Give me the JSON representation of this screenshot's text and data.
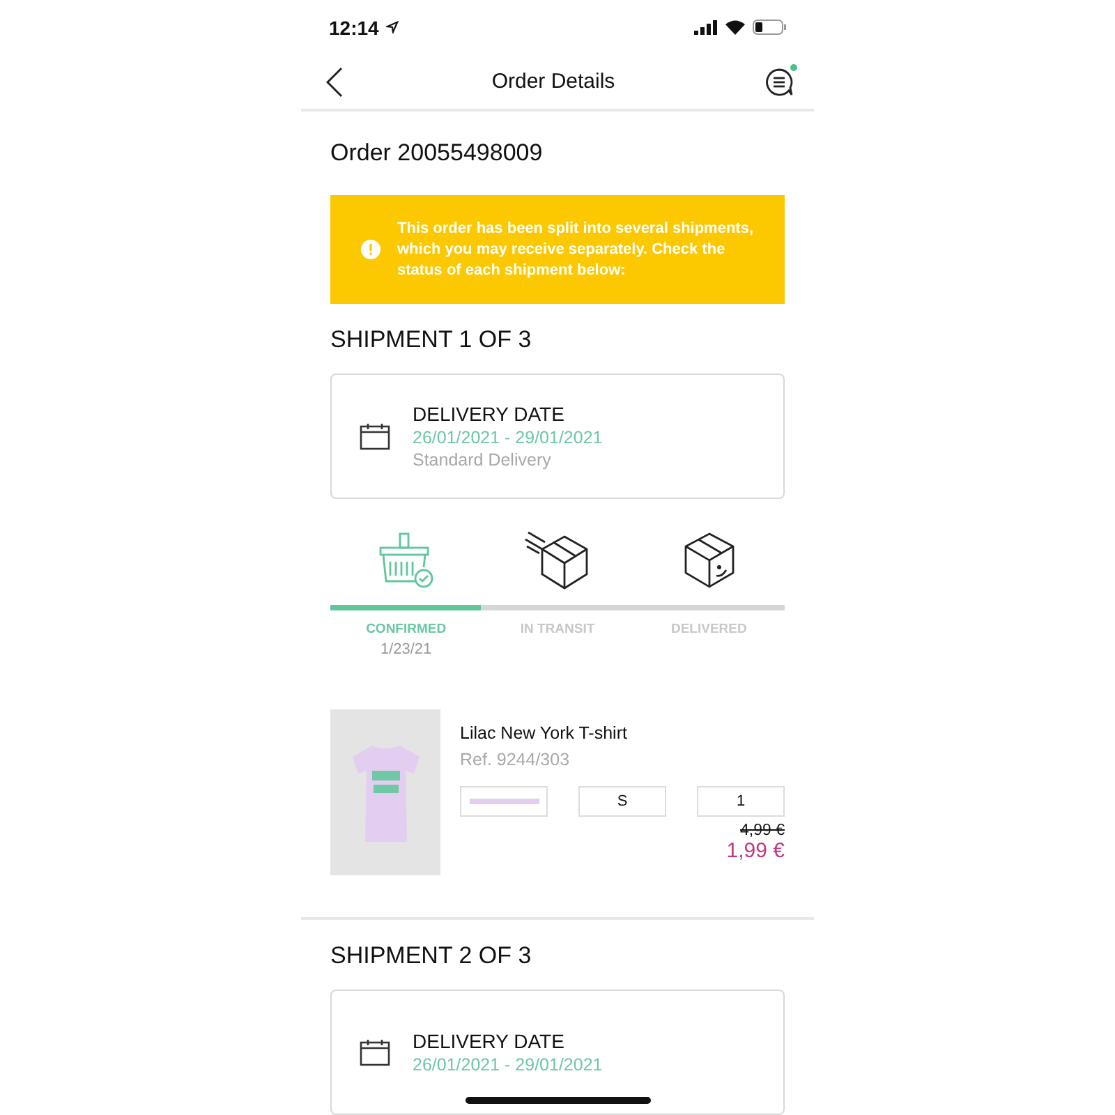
{
  "status_bar": {
    "time": "12:14"
  },
  "nav": {
    "title": "Order Details",
    "chat_unread": true
  },
  "order_title": "Order 20055498009",
  "banner": {
    "text": "This order has been split into several shipments, which you may receive separately. Check the status of each shipment below:"
  },
  "shipments": [
    {
      "heading": "SHIPMENT 1 OF 3",
      "delivery": {
        "label": "DELIVERY DATE",
        "dates": "26/01/2021 - 29/01/2021",
        "method": "Standard Delivery"
      },
      "progress": {
        "level": 0.33,
        "steps": [
          {
            "kind": "basket",
            "label": "CONFIRMED",
            "date": "1/23/21",
            "done": true
          },
          {
            "kind": "transit",
            "label": "IN TRANSIT",
            "done": false
          },
          {
            "kind": "delivered",
            "label": "DELIVERED",
            "done": false
          }
        ]
      },
      "items": [
        {
          "name": "Lilac New York T-shirt",
          "ref": "Ref.  9244/303",
          "color": "#e3cdf0",
          "size": "S",
          "quantity": "1",
          "old_price": "4,99 €",
          "price": "1,99 €"
        }
      ]
    },
    {
      "heading": "SHIPMENT 2 OF 3",
      "delivery": {
        "label": "DELIVERY DATE",
        "dates": "26/01/2021 - 29/01/2021"
      }
    }
  ]
}
